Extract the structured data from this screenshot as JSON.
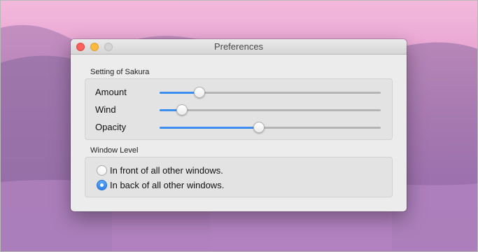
{
  "window": {
    "title": "Preferences"
  },
  "sakura": {
    "group_label": "Setting of Sakura",
    "sliders": [
      {
        "label": "Amount",
        "value": 0.18
      },
      {
        "label": "Wind",
        "value": 0.1
      },
      {
        "label": "Opacity",
        "value": 0.45
      }
    ]
  },
  "window_level": {
    "group_label": "Window Level",
    "options": [
      {
        "label": "In front of all other windows.",
        "selected": false
      },
      {
        "label": "In back of all other windows.",
        "selected": true
      }
    ]
  },
  "colors": {
    "accent": "#3b8ef0",
    "close": "#fc605c",
    "minimize": "#fdbc40",
    "zoom_disabled": "#d4d4d4"
  }
}
